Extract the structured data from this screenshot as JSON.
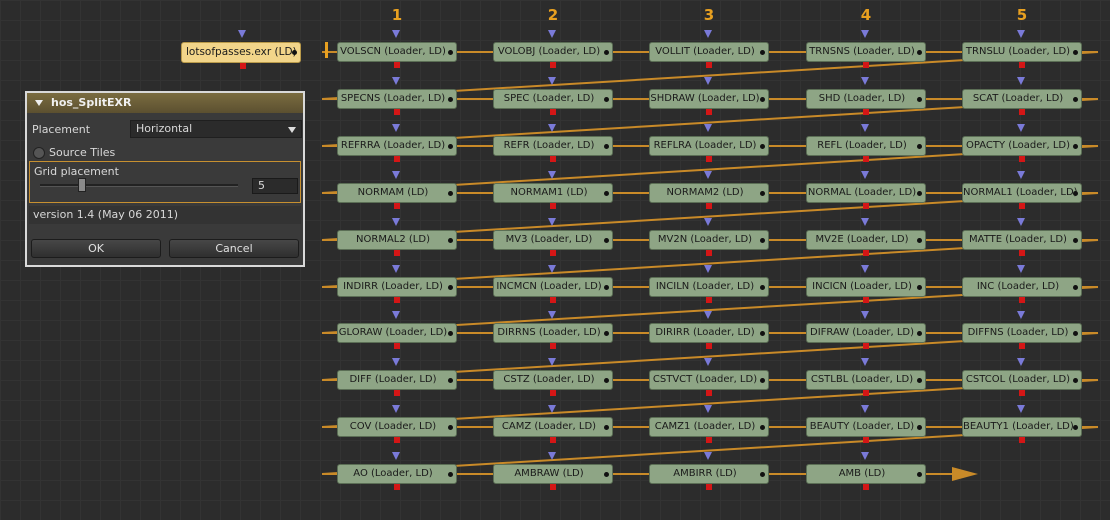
{
  "flow": {
    "columns": [
      "1",
      "2",
      "3",
      "4",
      "5"
    ],
    "source_node": "lotsofpasses.exr  (LD)",
    "rows": [
      [
        "VOLSCN  (Loader, LD)",
        "VOLOBJ  (Loader, LD)",
        "VOLLIT  (Loader, LD)",
        "TRNSNS  (Loader, LD)",
        "TRNSLU  (Loader, LD)"
      ],
      [
        "SPECNS  (Loader, LD)",
        "SPEC  (Loader, LD)",
        "SHDRAW  (Loader, LD)",
        "SHD  (Loader, LD)",
        "SCAT  (Loader, LD)"
      ],
      [
        "REFRRA  (Loader, LD)",
        "REFR  (Loader, LD)",
        "REFLRA  (Loader, LD)",
        "REFL  (Loader, LD)",
        "OPACTY  (Loader, LD)"
      ],
      [
        "NORMAM  (LD)",
        "NORMAM1  (LD)",
        "NORMAM2  (LD)",
        "NORMAL  (Loader, LD)",
        "NORMAL1  (Loader, LD)"
      ],
      [
        "NORMAL2  (LD)",
        "MV3  (Loader, LD)",
        "MV2N  (Loader, LD)",
        "MV2E  (Loader, LD)",
        "MATTE  (Loader, LD)"
      ],
      [
        "INDIRR  (Loader, LD)",
        "INCMCN  (Loader, LD)",
        "INCILN  (Loader, LD)",
        "INCICN  (Loader, LD)",
        "INC  (Loader, LD)"
      ],
      [
        "GLORAW  (Loader, LD)",
        "DIRRNS  (Loader, LD)",
        "DIRIRR  (Loader, LD)",
        "DIFRAW  (Loader, LD)",
        "DIFFNS  (Loader, LD)"
      ],
      [
        "DIFF  (Loader, LD)",
        "CSTZ  (Loader, LD)",
        "CSTVCT  (Loader, LD)",
        "CSTLBL  (Loader, LD)",
        "CSTCOL  (Loader, LD)"
      ],
      [
        "COV  (Loader, LD)",
        "CAMZ  (Loader, LD)",
        "CAMZ1  (Loader, LD)",
        "BEAUTY  (Loader, LD)",
        "BEAUTY1  (Loader, LD)"
      ],
      [
        "AO  (Loader, LD)",
        "AMBRAW  (LD)",
        "AMBIRR  (LD)",
        "AMB  (LD)"
      ]
    ],
    "colors": {
      "wire": "#c98a28",
      "node": "#8ea585",
      "source_node": "#f2d58a",
      "column_number": "#e8a020"
    }
  },
  "dialog": {
    "title": "hos_SplitEXR",
    "placement_label": "Placement",
    "placement_value": "Horizontal",
    "source_tiles_label": "Source Tiles",
    "grid_placement_label": "Grid placement",
    "grid_placement_value": "5",
    "version": "version 1.4 (May 06 2011)",
    "ok_label": "OK",
    "cancel_label": "Cancel"
  }
}
